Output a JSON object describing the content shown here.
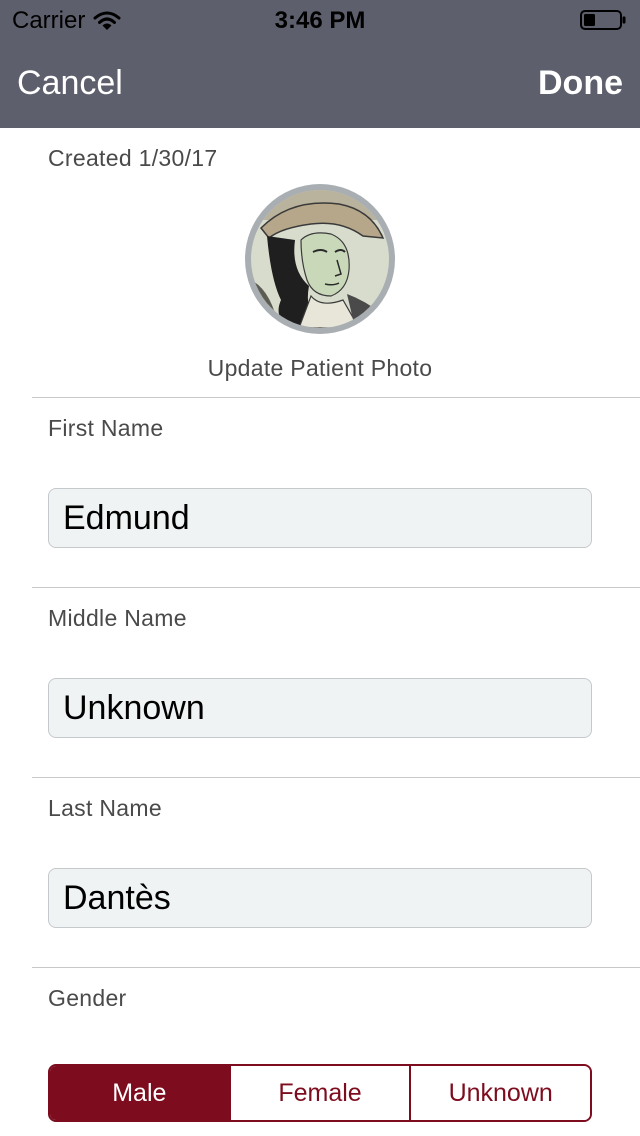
{
  "status_bar": {
    "carrier": "Carrier",
    "time": "3:46 PM",
    "wifi_icon": "wifi-icon",
    "battery_icon": "battery-icon"
  },
  "nav": {
    "cancel_label": "Cancel",
    "done_label": "Done"
  },
  "patient": {
    "created": "Created 1/30/17",
    "photo": "patient-photo",
    "update_photo_label": "Update Patient Photo"
  },
  "fields": {
    "first_name": {
      "label": "First Name",
      "value": "Edmund"
    },
    "middle_name": {
      "label": "Middle Name",
      "value": "Unknown"
    },
    "last_name": {
      "label": "Last Name",
      "value": "Dantès"
    }
  },
  "gender": {
    "label": "Gender",
    "options": [
      "Male",
      "Female",
      "Unknown"
    ],
    "selected": "Male"
  },
  "colors": {
    "nav_background": "#5d5f6c",
    "accent": "#7d0c1e",
    "field_background": "#f0f3f4",
    "photo_ring": "#a9aeb3"
  }
}
